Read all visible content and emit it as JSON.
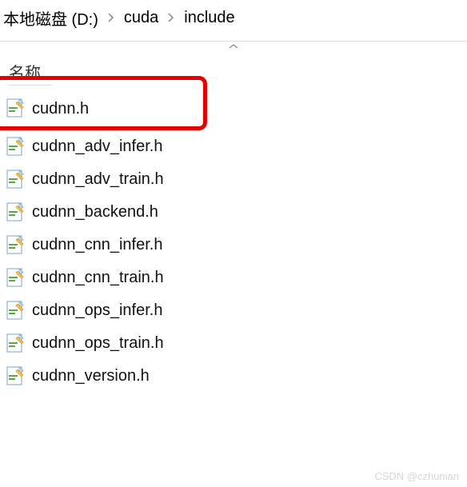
{
  "breadcrumb": {
    "items": [
      "本地磁盘 (D:)",
      "cuda",
      "include"
    ]
  },
  "column_header": "名称",
  "files": [
    {
      "name": "cudnn.h",
      "highlighted": true
    },
    {
      "name": "cudnn_adv_infer.h",
      "highlighted": false
    },
    {
      "name": "cudnn_adv_train.h",
      "highlighted": false
    },
    {
      "name": "cudnn_backend.h",
      "highlighted": false
    },
    {
      "name": "cudnn_cnn_infer.h",
      "highlighted": false
    },
    {
      "name": "cudnn_cnn_train.h",
      "highlighted": false
    },
    {
      "name": "cudnn_ops_infer.h",
      "highlighted": false
    },
    {
      "name": "cudnn_ops_train.h",
      "highlighted": false
    },
    {
      "name": "cudnn_version.h",
      "highlighted": false
    }
  ],
  "watermark": "CSDN @czhunian"
}
